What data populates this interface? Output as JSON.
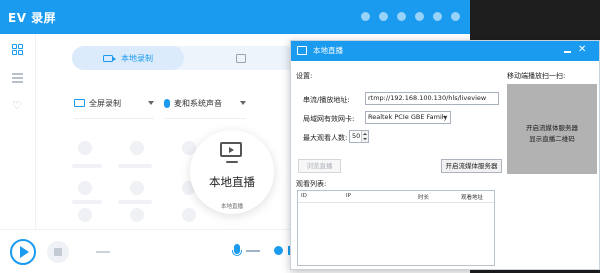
{
  "app": {
    "title": "EV 录屏"
  },
  "main": {
    "tabs": [
      {
        "label": "本地录制",
        "active": true
      },
      {
        "label": "",
        "active": false
      }
    ],
    "screen_select": "全屏录制",
    "audio_select": "麦和系统声音",
    "live_button": {
      "label": "本地直播",
      "caption": "本地直播"
    }
  },
  "dialog": {
    "title": "本地直播",
    "settings_label": "设置:",
    "push_url": {
      "label": "串流/播放地址:",
      "value": "rtmp://192.168.100.130/hls/liveview"
    },
    "nic": {
      "label": "局域网有效网卡:",
      "value": "Realtek PCIe GBE Family C"
    },
    "max_viewers": {
      "label": "最大观看人数:",
      "value": "50"
    },
    "browse_button": "浏览直播",
    "start_button": "开启流媒体服务器",
    "qr": {
      "label": "移动端播放扫一扫:",
      "line1": "开启流媒体服务器",
      "line2": "显示直播二维码"
    },
    "viewers": {
      "label": "观看列表:",
      "columns": [
        "ID",
        "IP",
        "时长",
        "观看地址"
      ],
      "rows": []
    }
  },
  "colors": {
    "accent": "#1a9bef",
    "dark_panel": "#1e1e1e",
    "qr_placeholder": "#b2b2b2"
  },
  "icons": {
    "sidebar": [
      "grid-icon",
      "list-icon",
      "heart-icon"
    ],
    "toolbar": [
      "play-icon",
      "stop-icon",
      "microphone-icon"
    ]
  }
}
